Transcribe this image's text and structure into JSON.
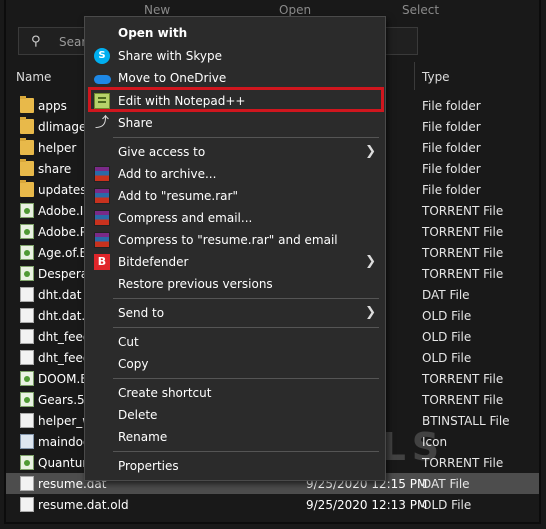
{
  "ribbon": {
    "new": "New",
    "open": "Open",
    "select": "Select"
  },
  "search": {
    "placeholder": "Sear"
  },
  "columns": {
    "name": "Name",
    "type": "Type"
  },
  "files": [
    {
      "name": "apps",
      "date": "",
      "type": "File folder",
      "icon": "folder-icon"
    },
    {
      "name": "dlimage",
      "date": "",
      "type": "File folder",
      "icon": "folder-icon"
    },
    {
      "name": "helper",
      "date": "",
      "type": "File folder",
      "icon": "folder-icon"
    },
    {
      "name": "share",
      "date": "",
      "type": "File folder",
      "icon": "folder-icon"
    },
    {
      "name": "updates",
      "date": "",
      "type": "File folder",
      "icon": "folder-icon"
    },
    {
      "name": "Adobe.Il",
      "date": "",
      "type": "TORRENT File",
      "icon": "torrent-file-icon"
    },
    {
      "name": "Adobe.P",
      "date": "",
      "type": "TORRENT File",
      "icon": "torrent-file-icon"
    },
    {
      "name": "Age.of.E",
      "date": "",
      "type": "TORRENT File",
      "icon": "torrent-file-icon"
    },
    {
      "name": "Desperac",
      "date": "",
      "type": "TORRENT File",
      "icon": "torrent-file-icon"
    },
    {
      "name": "dht.dat",
      "date": "",
      "type": "DAT File",
      "icon": "document-icon"
    },
    {
      "name": "dht.dat.c",
      "date": "",
      "type": "OLD File",
      "icon": "document-icon"
    },
    {
      "name": "dht_feed",
      "date": "",
      "type": "OLD File",
      "icon": "document-icon"
    },
    {
      "name": "dht_feed",
      "date": "",
      "type": "OLD File",
      "icon": "document-icon"
    },
    {
      "name": "DOOM.E",
      "date": "",
      "type": "TORRENT File",
      "icon": "torrent-file-icon"
    },
    {
      "name": "Gears.5-",
      "date": "",
      "type": "TORRENT File",
      "icon": "torrent-file-icon"
    },
    {
      "name": "helper_w",
      "date": "",
      "type": "BTINSTALL File",
      "icon": "document-icon"
    },
    {
      "name": "maindoo",
      "date": "",
      "type": "Icon",
      "icon": "icon-file-icon"
    },
    {
      "name": "Quantur",
      "date": "",
      "type": "TORRENT File",
      "icon": "torrent-file-icon"
    },
    {
      "name": "resume.dat",
      "date": "9/25/2020 12:15 PM",
      "type": "DAT File",
      "icon": "document-icon",
      "selected": true
    },
    {
      "name": "resume.dat.old",
      "date": "9/25/2020 12:13 PM",
      "type": "OLD File",
      "icon": "document-icon"
    }
  ],
  "menu": {
    "open_with": "Open with",
    "share_skype": "Share with Skype",
    "move_onedrive": "Move to OneDrive",
    "edit_notepad": "Edit with Notepad++",
    "share": "Share",
    "give_access": "Give access to",
    "add_archive": "Add to archive...",
    "add_resume_rar": "Add to \"resume.rar\"",
    "compress_email": "Compress and email...",
    "compress_resume_email": "Compress to \"resume.rar\" and email",
    "bitdefender": "Bitdefender",
    "restore_versions": "Restore previous versions",
    "send_to": "Send to",
    "cut": "Cut",
    "copy": "Copy",
    "create_shortcut": "Create shortcut",
    "delete": "Delete",
    "rename": "Rename",
    "properties": "Properties"
  },
  "watermark": "A PUALS",
  "colors": {
    "highlight_border": "#d0161e",
    "menu_bg": "#2b2b2b",
    "explorer_bg": "#191919"
  }
}
